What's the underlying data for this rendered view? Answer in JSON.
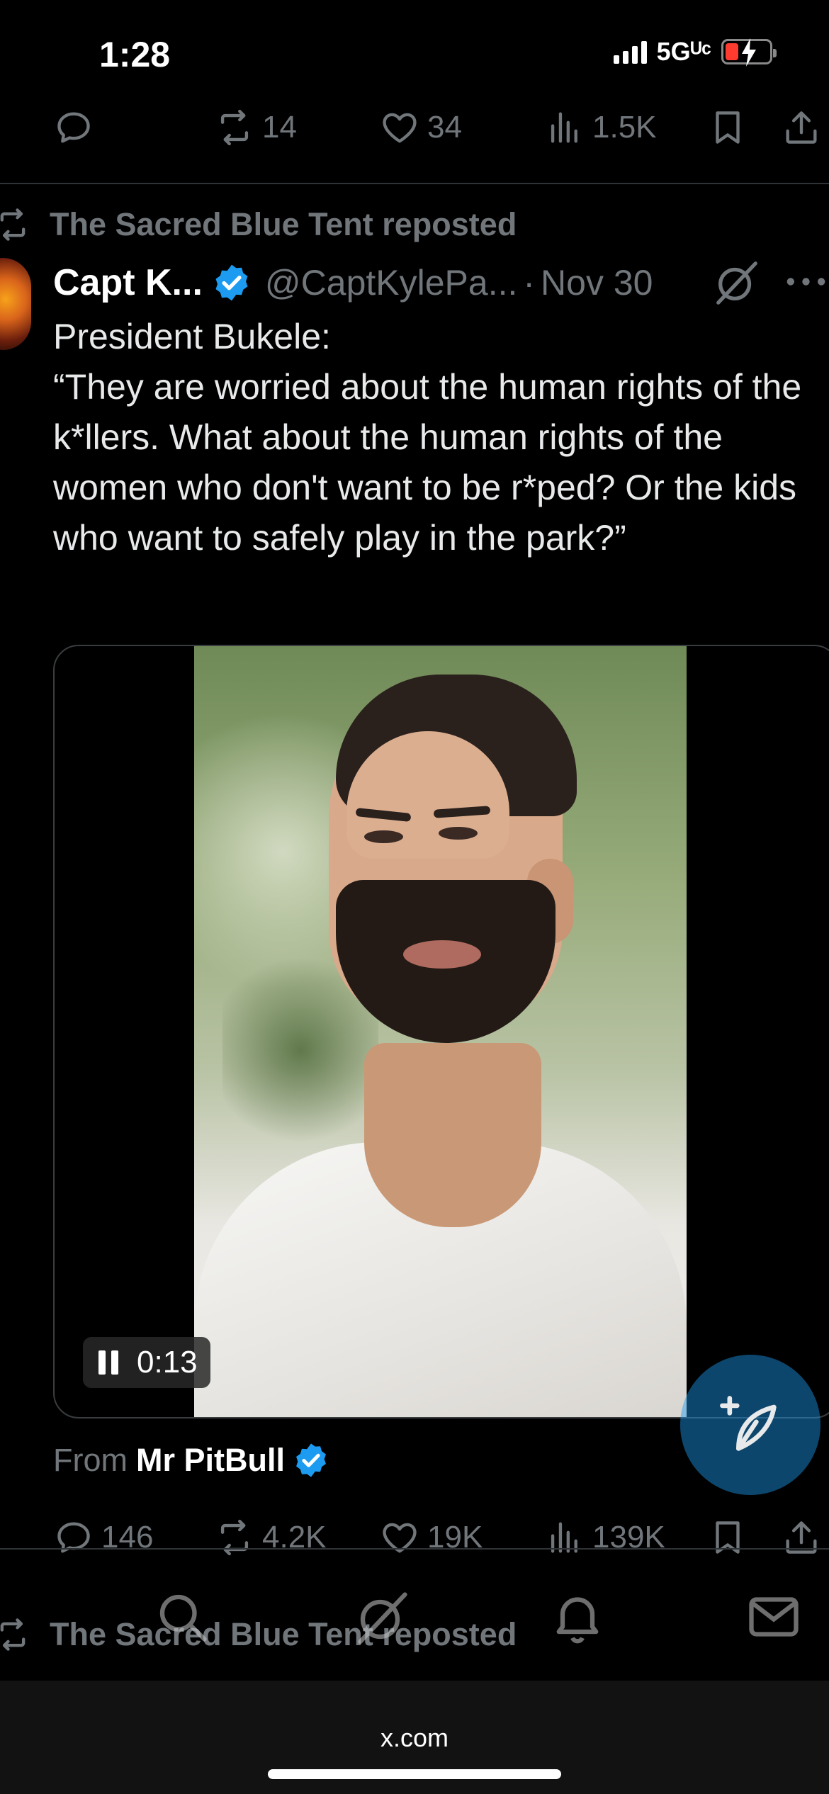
{
  "status": {
    "time": "1:28",
    "network": "5Gᵁᶜ"
  },
  "top_actions": {
    "retweets": "14",
    "likes": "34",
    "views": "1.5K"
  },
  "repost_label": "The Sacred Blue Tent reposted",
  "tweet": {
    "author_name": "Capt K...",
    "handle": "@CaptKylePa...",
    "separator": "·",
    "date": "Nov 30",
    "text_lines": [
      "President Bukele:",
      "“They are worried about the human rights of the k*llers. What about the human rights of the women who don't want to be r*ped? Or the kids who want to safely play in the park?”"
    ],
    "video_time": "0:13",
    "from_label": "From",
    "from_name": "Mr PitBull",
    "stats": {
      "replies": "146",
      "retweets": "4.2K",
      "likes": "19K",
      "views": "139K"
    }
  },
  "browser": {
    "url": "x.com"
  },
  "colors": {
    "background": "#000000",
    "muted": "#71767b",
    "verified": "#1d9bf0",
    "text": "#e7e9ea"
  }
}
